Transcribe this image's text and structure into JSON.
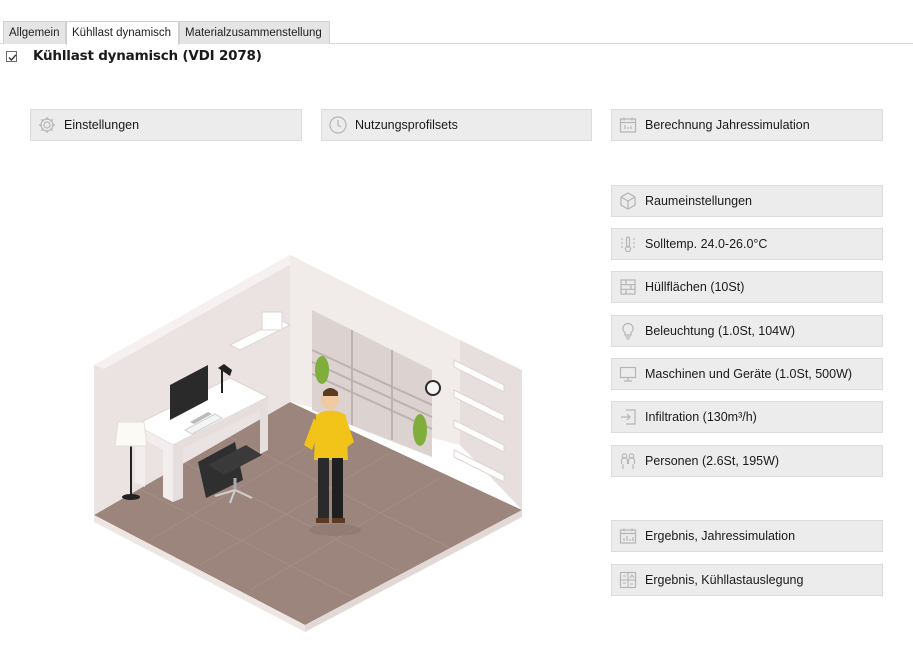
{
  "tabs": [
    {
      "label": "Allgemein",
      "active": false
    },
    {
      "label": "Kühllast dynamisch",
      "active": true
    },
    {
      "label": "Materialzusammenstellung",
      "active": false
    }
  ],
  "section": {
    "checked": true,
    "title": "Kühllast dynamisch (VDI 2078)"
  },
  "buttons": {
    "einstellungen": {
      "label": "Einstellungen",
      "icon": "gear-icon"
    },
    "nutzungsprofilsets": {
      "label": "Nutzungsprofilsets",
      "icon": "clock-icon"
    },
    "jahressimulation": {
      "label": "Berechnung Jahressimulation",
      "icon": "calendar-icon"
    },
    "raumeinstellungen": {
      "label": "Raumeinstellungen",
      "icon": "cube-icon"
    },
    "solltemp": {
      "label": "Solltemp. 24.0-26.0°C",
      "icon": "thermometer-icon"
    },
    "huellflaechen": {
      "label": "Hüllflächen (10St)",
      "icon": "wall-icon"
    },
    "beleuchtung": {
      "label": "Beleuchtung (1.0St, 104W)",
      "icon": "lightbulb-icon"
    },
    "maschinen": {
      "label": "Maschinen und Geräte (1.0St, 500W)",
      "icon": "monitor-icon"
    },
    "infiltration": {
      "label": "Infiltration (130m³/h)",
      "icon": "enter-icon"
    },
    "personen": {
      "label": "Personen (2.6St, 195W)",
      "icon": "people-icon"
    },
    "ergebnis_jahr": {
      "label": "Ergebnis, Jahressimulation",
      "icon": "calendar-chart-icon"
    },
    "ergebnis_kuehl": {
      "label": "Ergebnis, Kühllastauslegung",
      "icon": "report-icon"
    }
  }
}
